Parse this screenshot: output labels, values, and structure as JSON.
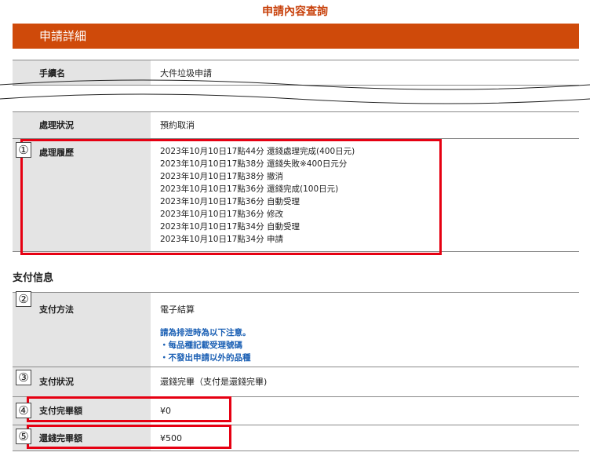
{
  "page": {
    "title": "申請內容查詢"
  },
  "details": {
    "section_title": "申請詳細",
    "procedure_name": {
      "label": "手續名",
      "value": "大件垃圾申請"
    },
    "processing_status": {
      "label": "處理狀況",
      "value": "預約取消"
    },
    "history": {
      "label": "處理履歷",
      "entries": [
        "2023年10月10日17點44分 還錢處理完成(400日元)",
        "2023年10月10日17點38分 還錢失敗※400日元分",
        "2023年10月10日17點38分 撤消",
        "2023年10月10日17點36分 還錢完成(100日元)",
        "2023年10月10日17點36分 自動受理",
        "2023年10月10日17點36分 修改",
        "2023年10月10日17點34分 自動受理",
        "2023年10月10日17點34分 申請"
      ]
    }
  },
  "payment": {
    "heading": "支付信息",
    "method": {
      "label": "支付方法",
      "value": "電子結算",
      "notes": [
        "請為排泄時為以下注意。",
        "・每品種記載受理號碼",
        "・不發出申請以外的品種"
      ]
    },
    "status": {
      "label": "支付狀況",
      "value": "還錢完畢（支付是還錢完畢)"
    },
    "paid_amount": {
      "label": "支付完畢額",
      "value": "¥0"
    },
    "refund_amount": {
      "label": "還錢完畢額",
      "value": "¥500"
    }
  },
  "markers": [
    "①",
    "②",
    "③",
    "④",
    "⑤"
  ],
  "colors": {
    "accent": "#cf4a0a",
    "highlight": "#e60012",
    "note_text": "#1a5fb4",
    "label_bg": "#e4e4e4"
  }
}
